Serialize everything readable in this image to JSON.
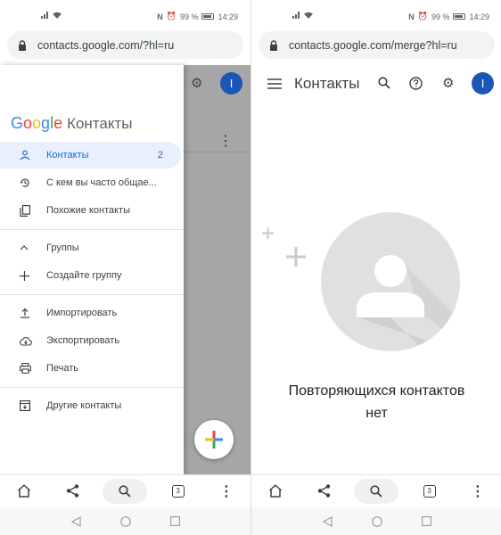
{
  "status": {
    "time": "14:29",
    "battery": "99 %"
  },
  "left": {
    "url": "contacts.google.com/?hl=ru",
    "logo": {
      "google": [
        "G",
        "o",
        "o",
        "g",
        "l",
        "e"
      ],
      "product": "Контакты"
    },
    "nav": [
      {
        "label": "Контакты",
        "count": "2"
      },
      {
        "label": "С кем вы часто общае..."
      },
      {
        "label": "Похожие контакты"
      },
      {
        "label": "Группы"
      },
      {
        "label": "Создайте группу"
      },
      {
        "label": "Импортировать"
      },
      {
        "label": "Экспортировать"
      },
      {
        "label": "Печать"
      },
      {
        "label": "Другие контакты"
      }
    ],
    "avatar": "I",
    "tabs_count": "3"
  },
  "right": {
    "url": "contacts.google.com/merge?hl=ru",
    "title": "Контакты",
    "avatar": "I",
    "empty_line1": "Повторяющихся контактов",
    "empty_line2": "нет",
    "tabs_count": "3"
  },
  "colors": {
    "accent": "#1967d2",
    "avatar": "#1a56b8",
    "selected_bg": "#e8f0fe"
  }
}
